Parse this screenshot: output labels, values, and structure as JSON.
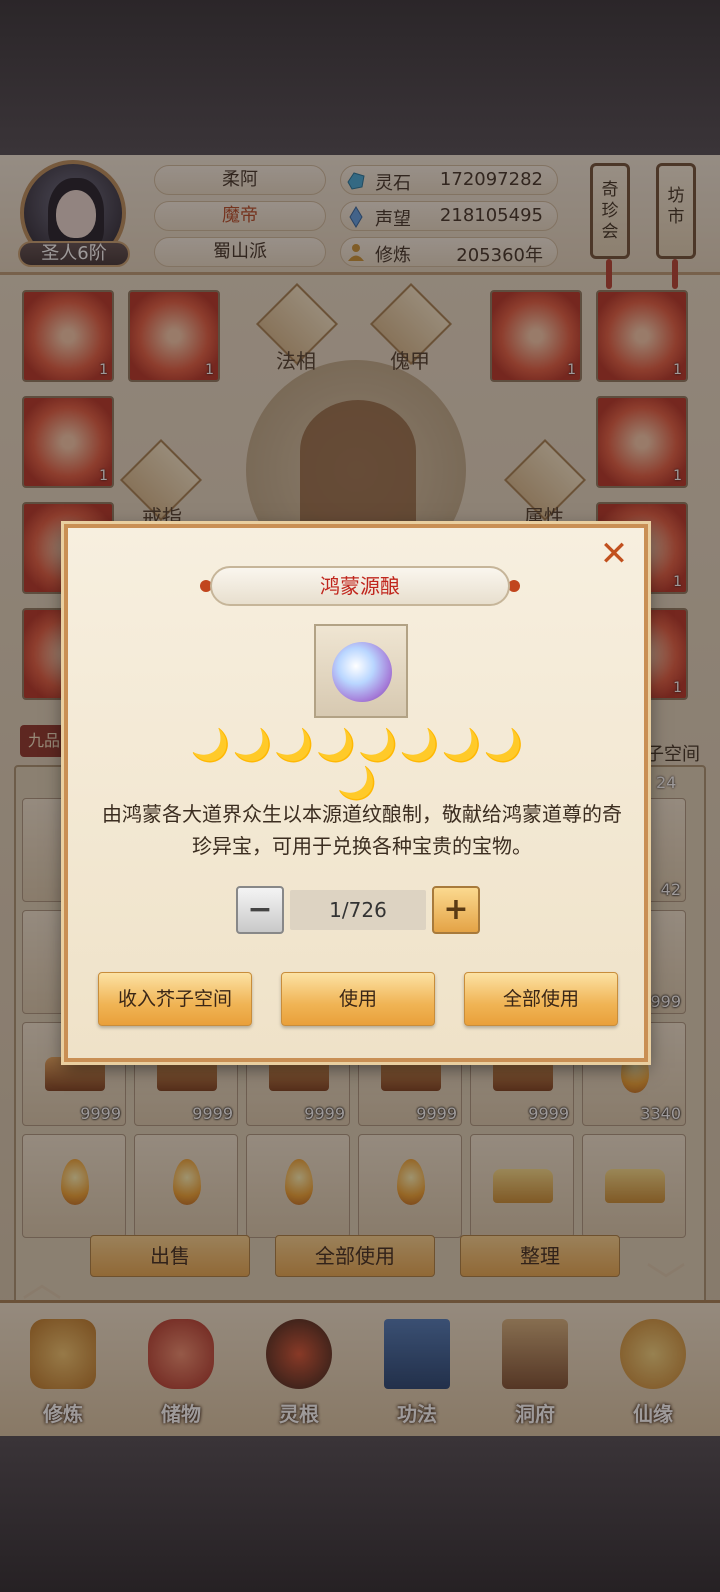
{
  "player": {
    "name": "柔阿",
    "title": "魔帝",
    "sect": "蜀山派",
    "rank": "圣人6阶"
  },
  "stats": [
    {
      "icon": "spirit-stone-icon",
      "label": "灵石",
      "value": "172097282"
    },
    {
      "icon": "prestige-icon",
      "label": "声望",
      "value": "218105495"
    },
    {
      "icon": "cultivation-icon",
      "label": "修炼",
      "value": "205360年"
    }
  ],
  "side_buttons": {
    "treasure_fair": "奇珍会",
    "market": "坊市"
  },
  "equipment": {
    "dharma_form": "法相",
    "armor": "傀甲",
    "ring": "戒指",
    "attributes": "属性",
    "slot_count": "1"
  },
  "inventory": {
    "grade_tag": "九品",
    "space_label": "子空间",
    "space_count": "24",
    "counts": [
      "42",
      "9999",
      "9999",
      "9999",
      "9999",
      "9999",
      "9999",
      "3340"
    ]
  },
  "actions": {
    "sell": "出售",
    "use_all": "全部使用",
    "sort": "整理"
  },
  "nav": [
    {
      "label": "修炼",
      "icon": "cultivate-icon"
    },
    {
      "label": "储物",
      "icon": "storage-bag-icon"
    },
    {
      "label": "灵根",
      "icon": "spirit-root-icon"
    },
    {
      "label": "功法",
      "icon": "skill-book-icon"
    },
    {
      "label": "洞府",
      "icon": "cave-house-icon"
    },
    {
      "label": "仙缘",
      "icon": "immortal-fate-icon"
    }
  ],
  "modal": {
    "title": "鸿蒙源酿",
    "close": "✕",
    "moons": "🌙🌙🌙🌙🌙🌙🌙🌙🌙",
    "description": "由鸿蒙各大道界众生以本源道纹酿制，敬献给鸿蒙道尊的奇珍异宝，可用于兑换各种宝贵的宝物。",
    "quantity": "1/726",
    "minus": "−",
    "plus": "+",
    "store_button": "收入芥子空间",
    "use_button": "使用",
    "use_all_button": "全部使用"
  }
}
